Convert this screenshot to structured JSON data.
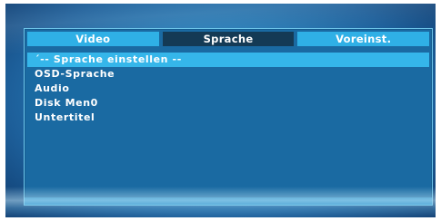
{
  "tabs": [
    {
      "label": "Video",
      "active": false
    },
    {
      "label": "Sprache",
      "active": true
    },
    {
      "label": "Voreinst.",
      "active": false
    }
  ],
  "menu_items": [
    {
      "label": "´-- Sprache einstellen --",
      "highlighted": true
    },
    {
      "label": "OSD-Sprache",
      "highlighted": false
    },
    {
      "label": "Audio",
      "highlighted": false
    },
    {
      "label": "Disk Men0",
      "highlighted": false
    },
    {
      "label": "Untertitel",
      "highlighted": false
    }
  ],
  "colors": {
    "tab_inactive": "#2fb0e6",
    "tab_active": "#143a55",
    "panel": "#1a6aa2",
    "highlight": "#35b6ea"
  }
}
